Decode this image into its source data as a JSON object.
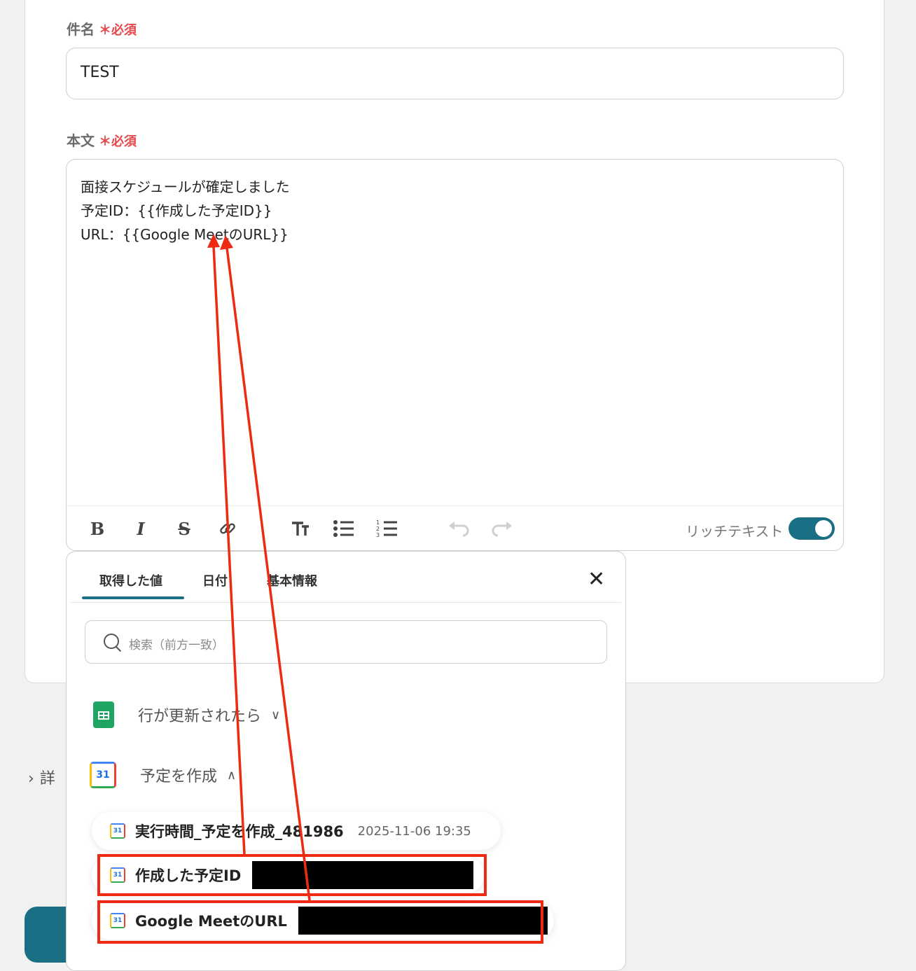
{
  "form": {
    "subject_label": "件名",
    "required_mark": "＊",
    "required_text": "必須",
    "subject_value": "TEST",
    "body_label": "本文",
    "body_lines": [
      "面接スケジュールが確定しました",
      "予定ID：{{作成した予定ID}}",
      "URL：{{Google MeetのURL}}"
    ]
  },
  "toolbar": {
    "bold": "B",
    "italic": "I",
    "strike": "S",
    "link_icon": "link-icon",
    "rich_text_label": "リッチテキスト",
    "rich_text_on": true
  },
  "popup": {
    "tabs": [
      "取得した値",
      "日付",
      "基本情報"
    ],
    "search_placeholder": "検索（前方一致）",
    "groups": [
      {
        "label": "行が更新されたら",
        "icon": "google-sheets-icon"
      },
      {
        "label": "予定を作成",
        "icon": "google-calendar-icon"
      }
    ],
    "items": [
      {
        "name": "実行時間_予定を作成_481986",
        "value": "2025-11-06 19:35"
      },
      {
        "name": "作成した予定ID",
        "value": ""
      },
      {
        "name": "Google MeetのURL",
        "value": ""
      }
    ]
  },
  "detail_label": "詳",
  "colors": {
    "accent": "#1a6f84",
    "required": "#e5484d",
    "highlight": "#ee2b12"
  }
}
